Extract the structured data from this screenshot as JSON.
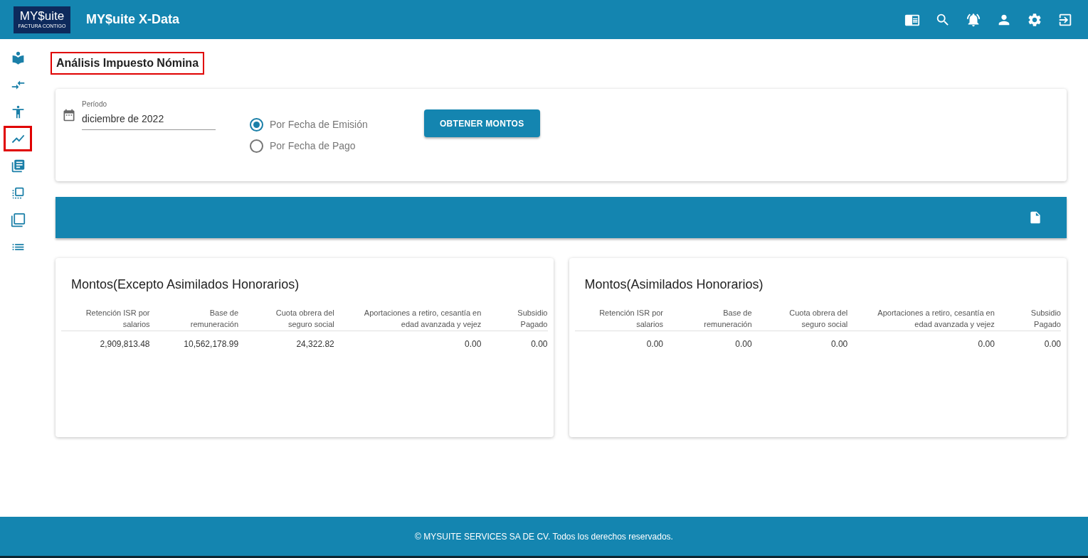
{
  "header": {
    "logo": {
      "text": "MY$uite",
      "tagline": "FACTURA CONTIGO"
    },
    "title": "MY$uite X-Data",
    "icons": [
      {
        "kind": "reader"
      },
      {
        "kind": "search"
      },
      {
        "kind": "alarm"
      },
      {
        "kind": "user"
      },
      {
        "kind": "settings"
      },
      {
        "kind": "exit"
      }
    ]
  },
  "sidebar": {
    "items": [
      {
        "kind": "library",
        "selected": false
      },
      {
        "kind": "arrows",
        "selected": false
      },
      {
        "kind": "person",
        "selected": false
      },
      {
        "kind": "chart",
        "selected": true
      },
      {
        "kind": "books",
        "selected": false
      },
      {
        "kind": "front",
        "selected": false
      },
      {
        "kind": "copy",
        "selected": false
      },
      {
        "kind": "list",
        "selected": false
      }
    ]
  },
  "page_title": {
    "text": "Análisis Impuesto Nómina",
    "highlighted": true
  },
  "filters": {
    "period": {
      "label": "Período",
      "value": "diciembre de 2022"
    },
    "options": [
      {
        "label": "Por Fecha de Emisión",
        "selected": true
      },
      {
        "label": "Por Fecha de Pago",
        "selected": false
      }
    ],
    "button": "OBTENER MONTOS"
  },
  "tables": [
    {
      "title": "Montos(Excepto Asimilados Honorarios)",
      "columns": [
        "Retención ISR por salarios",
        "Base de remuneración",
        "Cuota obrera del seguro social",
        "Aportaciones a retiro, cesantía en edad avanzada y vejez",
        "Subsidio Pagado"
      ],
      "rows": [
        [
          "2,909,813.48",
          "10,562,178.99",
          "24,322.82",
          "0.00",
          "0.00"
        ]
      ]
    },
    {
      "title": "Montos(Asimilados Honorarios)",
      "columns": [
        "Retención ISR por salarios",
        "Base de remuneración",
        "Cuota obrera del seguro social",
        "Aportaciones a retiro, cesantía en edad avanzada y vejez",
        "Subsidio Pagado"
      ],
      "rows": [
        [
          "0.00",
          "0.00",
          "0.00",
          "0.00",
          "0.00"
        ]
      ]
    }
  ],
  "footer": "© MYSUITE SERVICES SA DE CV. Todos los derechos reservados."
}
